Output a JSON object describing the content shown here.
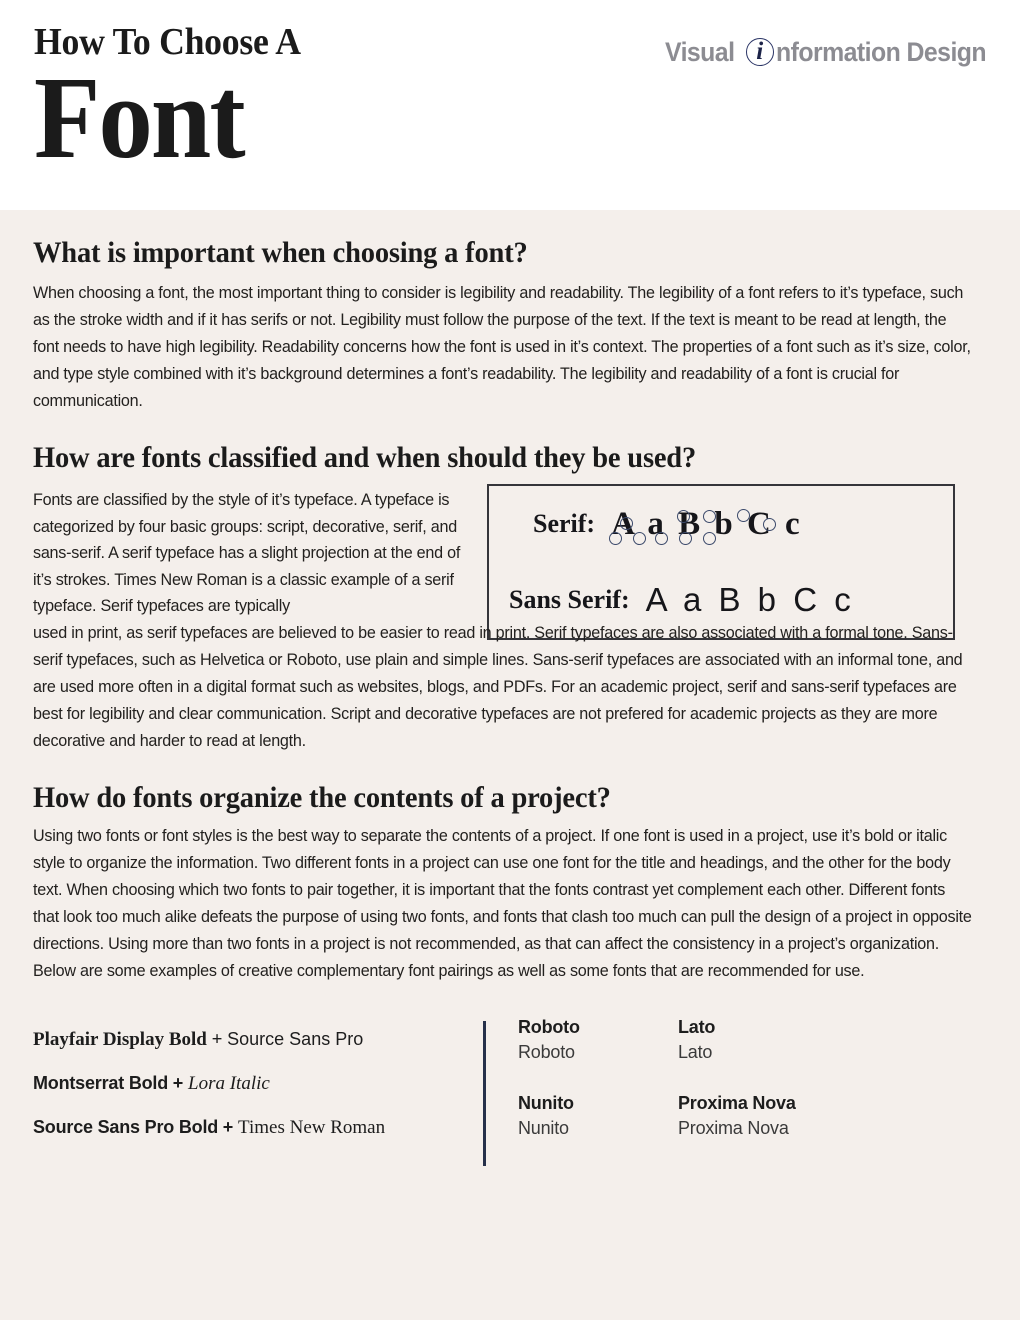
{
  "header": {
    "title_line1": "How To Choose A",
    "title_line2": "Font",
    "brand": {
      "word_before": "Visual",
      "circled_letter": "i",
      "word_after": "nformation Design",
      "circle_color": "#2b3566",
      "text_color": "#8c8c92"
    }
  },
  "sections": [
    {
      "heading": "What is important when choosing a font?",
      "body": "When choosing a font, the most important thing to consider is legibility and readability. The legibility of a font refers to it’s typeface, such as the stroke width and if it has serifs or not. Legibility must follow the purpose of the text. If the text is meant to be read at length, the font needs to have high legibility. Readability concerns how the font is used in it’s context. The properties of a font such as it’s size, color, and type style combined with it’s background determines a font’s readability. The legibility and readability of a font is crucial for communication."
    },
    {
      "heading": "How are fonts classified and when should they be used?",
      "body_column": "Fonts are classified by the style of it’s typeface. A typeface is categorized by four basic groups: script, decorative, serif, and sans-serif. A serif typeface has a slight projection at the end of it’s strokes. Times New Roman is a classic example of a serif typeface. Serif typefaces are typically",
      "body_tail": "used in print, as serif typefaces are believed to be easier to read in print. Serif typefaces are also associated with a formal tone. Sans-serif typefaces, such as Helvetica or Roboto, use plain and simple lines. Sans-serif typefaces are associated with an informal tone, and are used more often in a digital format such as websites, blogs, and PDFs. For an academic project, serif and sans-serif typefaces are best for legibility and clear communication. Script and decorative typefaces are not prefered for academic projects as they are more decorative and harder to read at length."
    },
    {
      "heading": "How do fonts organize the contents of a project?",
      "body": "Using two fonts or font styles is the best way to separate the contents of a project. If one font is used in a project, use it’s bold or italic style to organize the information. Two different fonts in a project can use one font for the title and headings, and the other for the body text. When choosing which two fonts to pair together, it is important that the fonts contrast yet complement each other. Different fonts that look too much alike defeats the purpose of using two fonts, and fonts that clash too much can pull the design of a project in opposite directions. Using more than two fonts in a project is not recommended, as that can affect the consistency in a project’s organization. Below are some examples of creative complementary font pairings as well as some fonts that are recommended for use."
    }
  ],
  "sample_box": {
    "serif_label": "Serif:",
    "serif_glyphs": "A a B b C c",
    "sans_label": "Sans Serif:",
    "sans_glyphs": "A a B b C c",
    "annotation_color": "#3c4a6b",
    "border_color": "#35353a"
  },
  "pairings": [
    {
      "first": "Playfair Display Bold",
      "plus": "+",
      "second": "Source Sans Pro",
      "first_style": "serif-bold",
      "second_style": "sans-regular"
    },
    {
      "first": "Montserrat Bold",
      "plus": "+",
      "second": "Lora Italic",
      "first_style": "sans-bold",
      "second_style": "serif-italic"
    },
    {
      "first": "Source Sans Pro Bold",
      "plus": "+",
      "second": "Times New Roman",
      "first_style": "sans-bold",
      "second_style": "serif-regular"
    }
  ],
  "recommended_fonts": [
    {
      "bold": "Roboto",
      "regular": "Roboto"
    },
    {
      "bold": "Lato",
      "regular": "Lato"
    },
    {
      "bold": "Nunito",
      "regular": "Nunito"
    },
    {
      "bold": "Proxima Nova",
      "regular": "Proxima Nova"
    }
  ],
  "colors": {
    "header_background": "#ffffff",
    "page_background": "#f4efeb",
    "text": "#23211f",
    "divider": "#26304a"
  }
}
